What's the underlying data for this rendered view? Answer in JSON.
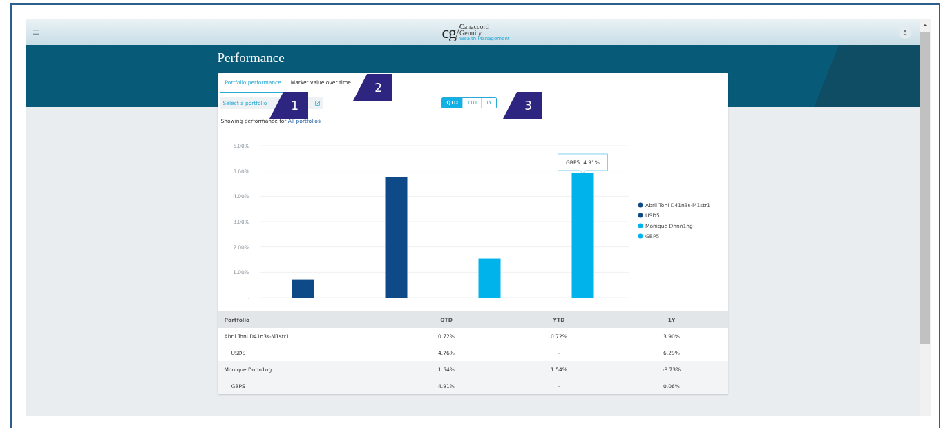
{
  "header": {
    "logo": {
      "mark": "cg",
      "line_1": "Canaccord",
      "line_2": "Genuity",
      "tagline": "Wealth Management"
    }
  },
  "page_title": "Performance",
  "tabs": [
    {
      "label": "Portfolio performance",
      "selected": true
    },
    {
      "label": "Market value over time",
      "selected": false
    }
  ],
  "portfolio_select": {
    "placeholder": "Select a portfolio"
  },
  "showing": {
    "label": "Showing performance for",
    "link": "All portfolios"
  },
  "periods": [
    {
      "label": "QTD",
      "selected": true
    },
    {
      "label": "YTD",
      "selected": false
    },
    {
      "label": "1Y",
      "selected": false
    }
  ],
  "chart_data": {
    "type": "bar",
    "ylim": [
      0,
      6
    ],
    "yticks": [
      {
        "value": 0,
        "label": "-"
      },
      {
        "value": 1,
        "label": "1.00%"
      },
      {
        "value": 2,
        "label": "2.00%"
      },
      {
        "value": 3,
        "label": "3.00%"
      },
      {
        "value": 4,
        "label": "4.00%"
      },
      {
        "value": 5,
        "label": "5.00%"
      },
      {
        "value": 6,
        "label": "6.00%"
      }
    ],
    "series": [
      {
        "name": "Abril Toni D41n3s-M1str1",
        "color": "#0e4a87",
        "values": [
          0.72
        ]
      },
      {
        "name": "USD5",
        "color": "#0e4a87",
        "values": [
          4.76
        ]
      },
      {
        "name": "Monique Dnnn1ng",
        "color": "#00b4eb",
        "values": [
          1.54
        ]
      },
      {
        "name": "GBP5",
        "color": "#00b4eb",
        "values": [
          4.91
        ]
      }
    ],
    "grid": true,
    "legend": true,
    "annotations": [
      "GBP5: 4.91%"
    ]
  },
  "table": {
    "columns": [
      "Portfolio",
      "QTD",
      "YTD",
      "1Y"
    ],
    "rows": [
      {
        "cells": [
          "Abril Toni D41n3s-M1str1",
          "0.72%",
          "0.72%",
          "3.90%"
        ],
        "children": [
          {
            "cells": [
              "USDS",
              "4.76%",
              "-",
              "6.29%"
            ]
          }
        ]
      },
      {
        "cells": [
          "Monique Dnnn1ng",
          "1.54%",
          "1.54%",
          "-8.73%"
        ],
        "children": [
          {
            "cells": [
              "GBPS",
              "4.91%",
              "-",
              "0.06%"
            ]
          }
        ]
      }
    ]
  },
  "callouts": [
    "1",
    "2",
    "3"
  ]
}
